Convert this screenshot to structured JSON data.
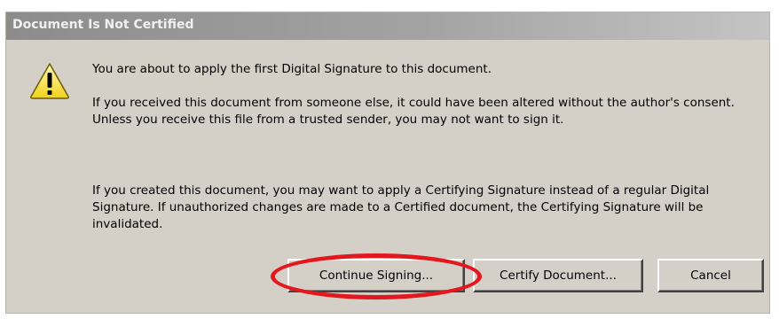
{
  "dialog": {
    "title": "Document Is Not Certified",
    "icon": "warning-triangle-icon",
    "message_1": "You are about to apply the first Digital Signature to this document.",
    "message_2": "If you received this document from someone else, it could have been altered without the author's consent. Unless you receive this file from a trusted sender, you may not want to sign it.",
    "message_3": "If you created this document, you may want to apply a Certifying Signature instead of a regular Digital Signature. If unauthorized changes are made to a Certified document, the Certifying Signature will be invalidated."
  },
  "buttons": {
    "continue_label": "Continue Signing...",
    "certify_label": "Certify Document...",
    "cancel_label": "Cancel"
  },
  "annotation": {
    "highlight_color": "#e3181e",
    "highlight_target": "Continue Signing..."
  }
}
